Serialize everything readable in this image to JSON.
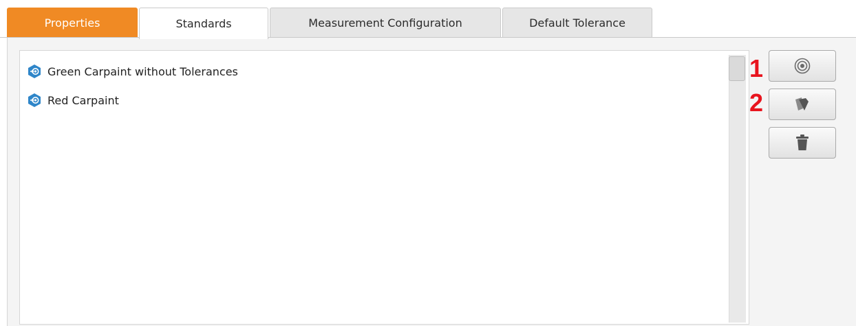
{
  "tabs": [
    {
      "label": "Properties",
      "style": "orange"
    },
    {
      "label": "Standards",
      "active": true
    },
    {
      "label": "Measurement Configuration"
    },
    {
      "label": "Default Tolerance"
    }
  ],
  "standards": {
    "items": [
      {
        "label": "Green Carpaint without Tolerances",
        "icon": "standard-icon"
      },
      {
        "label": "Red Carpaint",
        "icon": "standard-icon"
      }
    ]
  },
  "side_buttons": [
    {
      "icon": "target-icon"
    },
    {
      "icon": "swatch-cards-icon"
    },
    {
      "icon": "trash-icon"
    }
  ],
  "markers": [
    "1",
    "2"
  ],
  "colors": {
    "accent_orange": "#f08a24",
    "icon_blue": "#2f86c9",
    "marker_red": "#e8141e"
  }
}
